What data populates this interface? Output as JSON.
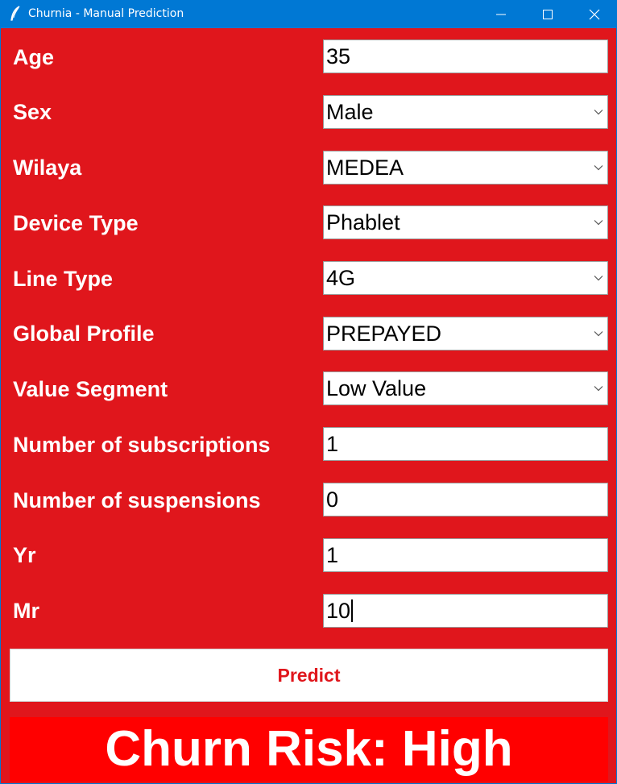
{
  "window": {
    "title": "Churnia - Manual Prediction",
    "titlebar_color": "#0078d4",
    "background_color": "#e0161c"
  },
  "titlebar_buttons": [
    "minimize-icon",
    "maximize-icon",
    "close-icon"
  ],
  "form": {
    "age": {
      "label": "Age",
      "value": "35"
    },
    "sex": {
      "label": "Sex",
      "value": "Male"
    },
    "wilaya": {
      "label": "Wilaya",
      "value": "MEDEA"
    },
    "device_type": {
      "label": "Device Type",
      "value": "Phablet"
    },
    "line_type": {
      "label": "Line Type",
      "value": "4G"
    },
    "global_profile": {
      "label": "Global Profile",
      "value": "PREPAYED"
    },
    "value_segment": {
      "label": "Value Segment",
      "value": "Low Value"
    },
    "num_subscriptions": {
      "label": "Number of subscriptions",
      "value": "1"
    },
    "num_suspensions": {
      "label": "Number of suspensions",
      "value": "0"
    },
    "yr": {
      "label": "Yr",
      "value": "1"
    },
    "mr": {
      "label": "Mr",
      "value": "10"
    }
  },
  "predict_button": {
    "label": "Predict"
  },
  "result": {
    "text": "Churn Risk: High",
    "color": "#ff0000"
  }
}
